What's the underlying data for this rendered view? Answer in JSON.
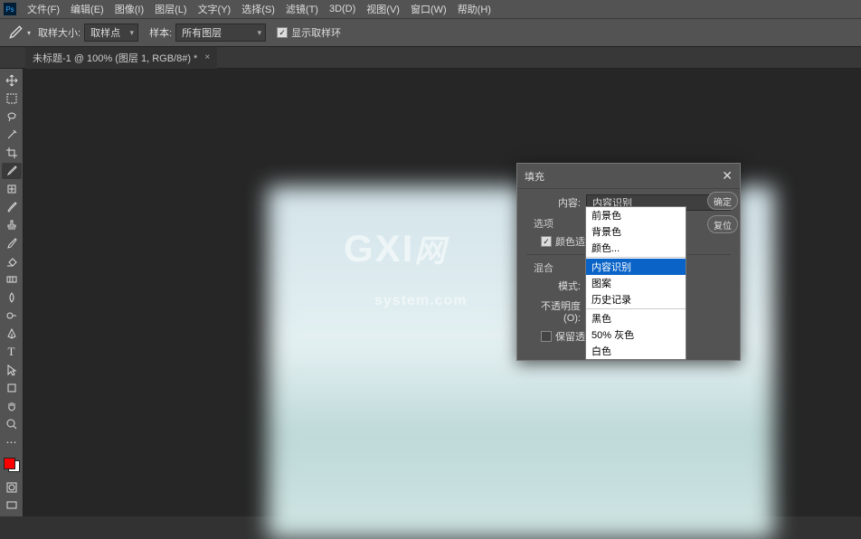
{
  "menubar": {
    "items": [
      {
        "label": "文件(F)"
      },
      {
        "label": "编辑(E)"
      },
      {
        "label": "图像(I)"
      },
      {
        "label": "图层(L)"
      },
      {
        "label": "文字(Y)"
      },
      {
        "label": "选择(S)"
      },
      {
        "label": "滤镜(T)"
      },
      {
        "label": "3D(D)"
      },
      {
        "label": "视图(V)"
      },
      {
        "label": "窗口(W)"
      },
      {
        "label": "帮助(H)"
      }
    ]
  },
  "optbar": {
    "sample_size_label": "取样大小:",
    "sample_size_value": "取样点",
    "sample_label": "样本:",
    "sample_value": "所有图层",
    "show_ring_label": "显示取样环"
  },
  "tab": {
    "title": "未标题-1 @ 100% (图层 1, RGB/8#) *",
    "close": "×"
  },
  "watermark": {
    "line1": "GXI",
    "line2": "网",
    "sub": "system.com"
  },
  "dialog": {
    "title": "填充",
    "content_label": "内容:",
    "content_value": "内容识别",
    "options_label": "选项",
    "color_adapt_label": "颜色适应(C)",
    "blend_label": "混合",
    "mode_label": "模式:",
    "opacity_label": "不透明度(O):",
    "preserve_label": "保留透明区域(P)",
    "ok": "确定",
    "reset": "复位"
  },
  "dropdown": {
    "options": [
      {
        "label": "前景色"
      },
      {
        "label": "背景色"
      },
      {
        "label": "颜色..."
      },
      {
        "label": "内容识别",
        "selected": true
      },
      {
        "label": "图案"
      },
      {
        "label": "历史记录"
      },
      {
        "label": "黑色"
      },
      {
        "label": "50% 灰色"
      },
      {
        "label": "白色"
      }
    ]
  }
}
